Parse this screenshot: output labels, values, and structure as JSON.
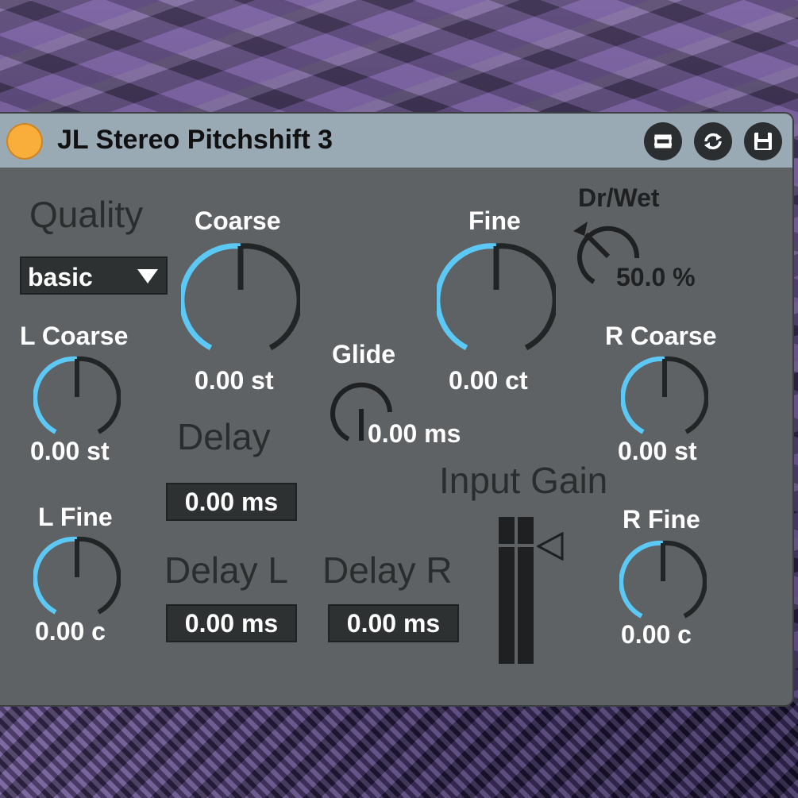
{
  "device": {
    "title": "JL Stereo Pitchshift 3",
    "accent": "#5bc8f5",
    "power_color": "#f9ad3b"
  },
  "quality": {
    "label": "Quality",
    "selected": "basic"
  },
  "coarse": {
    "label": "Coarse",
    "value": "0.00 st",
    "level": 0.5
  },
  "fine": {
    "label": "Fine",
    "value": "0.00 ct",
    "level": 0.5
  },
  "drywet": {
    "label": "Dr/Wet",
    "value": "50.0 %"
  },
  "glide": {
    "label": "Glide",
    "value": "0.00 ms"
  },
  "l_coarse": {
    "label": "L Coarse",
    "value": "0.00 st"
  },
  "r_coarse": {
    "label": "R Coarse",
    "value": "0.00 st"
  },
  "l_fine": {
    "label": "L Fine",
    "value": "0.00 c"
  },
  "r_fine": {
    "label": "R Fine",
    "value": "0.00 c"
  },
  "delay": {
    "label": "Delay",
    "value": "0.00 ms"
  },
  "delay_l": {
    "label": "Delay L",
    "value": "0.00 ms"
  },
  "delay_r": {
    "label": "Delay R",
    "value": "0.00 ms"
  },
  "input_gain": {
    "label": "Input Gain"
  },
  "icons": [
    "power-icon",
    "expand-icon",
    "hot-swap-icon",
    "save-icon",
    "dropdown-arrow-icon"
  ]
}
